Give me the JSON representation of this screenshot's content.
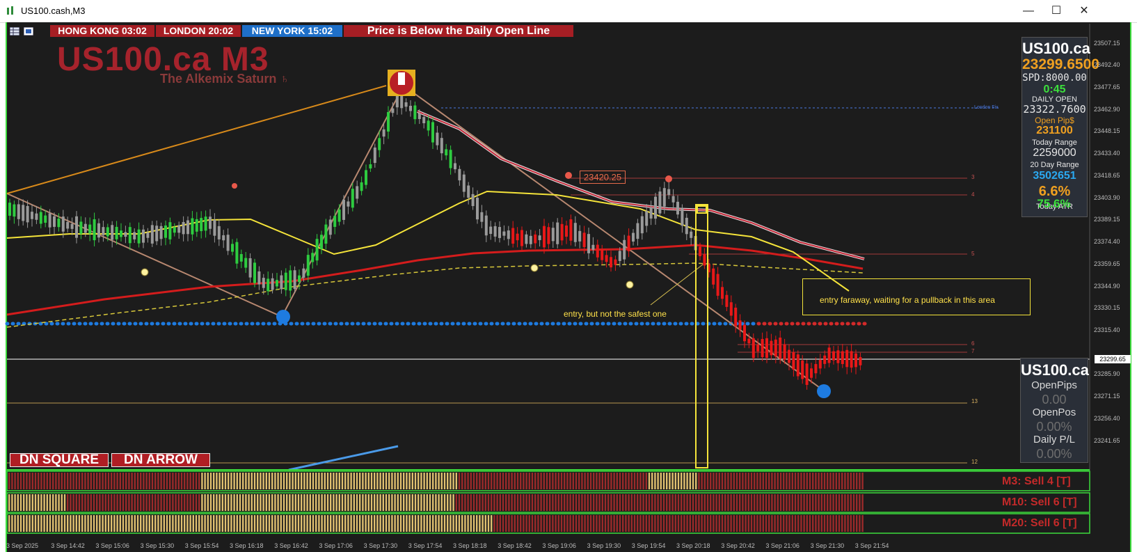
{
  "window": {
    "title": "US100.cash,M3",
    "minimize": "—",
    "maximize": "☐",
    "close": "✕"
  },
  "sessions": [
    {
      "label": "HONG KONG 03:02",
      "color": "#a61e24"
    },
    {
      "label": "LONDON  20:02",
      "color": "#a61e24"
    },
    {
      "label": "NEW YORK    15:02",
      "color": "#1e6fc8"
    }
  ],
  "banner": "Price is Below the Daily Open Line",
  "header": {
    "symbol_title": "US100.ca M3",
    "subtitle": "The Alkemix Saturn ♄"
  },
  "info_panel": {
    "symbol": "US100.ca",
    "price": "23299.6500",
    "spread": "SPD:8000.00",
    "timer": "0:45",
    "daily_open_label": "DAILY OPEN",
    "daily_open": "23322.7600",
    "open_pips_label": "Open Pip$",
    "open_pips": "231100",
    "today_range_label": "Today Range",
    "today_range": "2259000",
    "day20_range_label": "20 Day Range",
    "day20_range": "3502651",
    "pct": "6.6%",
    "today_atr_label": "Today ATR",
    "today_atr": "75.6%"
  },
  "position_panel": {
    "symbol": "US100.ca",
    "open_pips_label": "OpenPips",
    "open_pips": "0.00",
    "open_pos_label": "OpenPos",
    "open_pos": "0.00%",
    "daily_pl_label": "Daily P/L",
    "daily_pl": "0.00%"
  },
  "buttons": {
    "dn_square": "DN SQUARE",
    "dn_arrow": "DN ARROW"
  },
  "signals": {
    "m3": "M3: Sell 4 [T]",
    "m10": "M10: Sell 6 [T]",
    "m20": "M20: Sell 6 [T]"
  },
  "annotations": {
    "entry1": "entry, but not the safest one",
    "entry2": "entry faraway, waiting for a pullback in this area",
    "level_label": "23420.25",
    "london_fix": "London Fix",
    "current_price_tag": "23299.65",
    "level_numbers": [
      "3",
      "4",
      "5",
      "6",
      "7",
      "13",
      "12"
    ]
  },
  "price_axis": [
    "23507.15",
    "23492.40",
    "23477.65",
    "23462.90",
    "23448.15",
    "23433.40",
    "23418.65",
    "23403.90",
    "23389.15",
    "23374.40",
    "23359.65",
    "23344.90",
    "23330.15",
    "23315.40",
    "23285.90",
    "23271.15",
    "23256.40",
    "23241.65"
  ],
  "time_axis": [
    "3 Sep 2025",
    "3 Sep 14:42",
    "3 Sep 15:06",
    "3 Sep 15:30",
    "3 Sep 15:54",
    "3 Sep 16:18",
    "3 Sep 16:42",
    "3 Sep 17:06",
    "3 Sep 17:30",
    "3 Sep 17:54",
    "3 Sep 18:18",
    "3 Sep 18:42",
    "3 Sep 19:06",
    "3 Sep 19:30",
    "3 Sep 19:54",
    "3 Sep 20:18",
    "3 Sep 20:42",
    "3 Sep 21:06",
    "3 Sep 21:30",
    "3 Sep 21:54"
  ],
  "colors": {
    "background": "#1c1c1c",
    "bull": "#2ecc40",
    "bear": "#e81818",
    "neutral": "#9a9a9a",
    "yellow": "#f5e43a",
    "red_ma": "#d41c1c",
    "frame": "#3cdc3c",
    "blue_dots": "#1e7be0"
  }
}
